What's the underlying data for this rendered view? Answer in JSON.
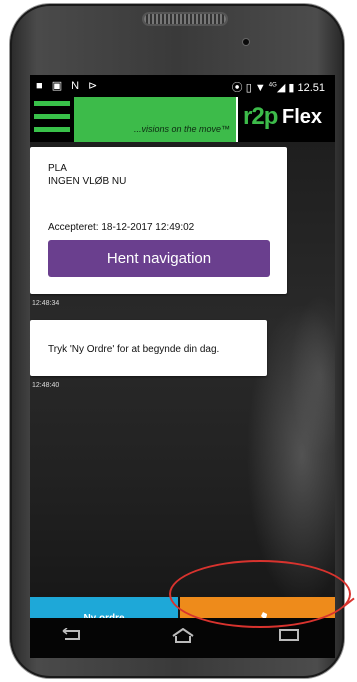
{
  "status_bar": {
    "time": "12.51",
    "network": "4G"
  },
  "app_bar": {
    "tagline": "...visions on the move™",
    "logo_r2p": "r2p",
    "logo_flex": "Flex"
  },
  "messages": [
    {
      "line1": "PLA",
      "line2": "INGEN VLØB NU",
      "accepted": "Accepteret: 18-12-2017 12:49:02",
      "button_label": "Hent navigation",
      "timestamp": "12:48:34"
    },
    {
      "text": "Tryk 'Ny Ordre' for at begynde din dag.",
      "timestamp": "12:48:40"
    }
  ],
  "bottom_buttons": {
    "new_order": "Ny ordre",
    "call_icon": "phone-icon"
  },
  "colors": {
    "brand_green": "#3dbb4a",
    "purple_button": "#6a3f8e",
    "blue_button": "#1ea8d8",
    "orange_button": "#ee8b1b",
    "annotation_red": "#d8332e"
  }
}
